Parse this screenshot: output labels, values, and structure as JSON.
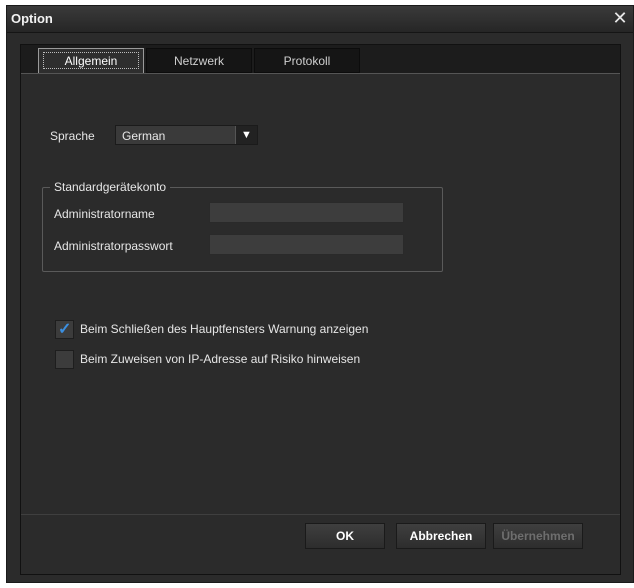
{
  "window": {
    "title": "Option",
    "close_glyph": "✕"
  },
  "tabs": [
    {
      "label": "Allgemein",
      "active": true
    },
    {
      "label": "Netzwerk",
      "active": false
    },
    {
      "label": "Protokoll",
      "active": false
    }
  ],
  "general": {
    "language_label": "Sprache",
    "language_value": "German",
    "account_group_title": "Standardgerätekonto",
    "admin_name_label": "Administratorname",
    "admin_name_value": "",
    "admin_password_label": "Administratorpasswort",
    "admin_password_value": "",
    "warn_on_close_label": "Beim Schließen des Hauptfensters Warnung anzeigen",
    "warn_on_close_checked": true,
    "ip_risk_label": "Beim Zuweisen von IP-Adresse auf Risiko hinweisen",
    "ip_risk_checked": false
  },
  "buttons": {
    "ok": "OK",
    "cancel": "Abbrechen",
    "apply": "Übernehmen"
  },
  "colors": {
    "background": "#2b2b2b",
    "checkmark": "#3b8fe0",
    "disabled_text": "#6e6e6e"
  }
}
